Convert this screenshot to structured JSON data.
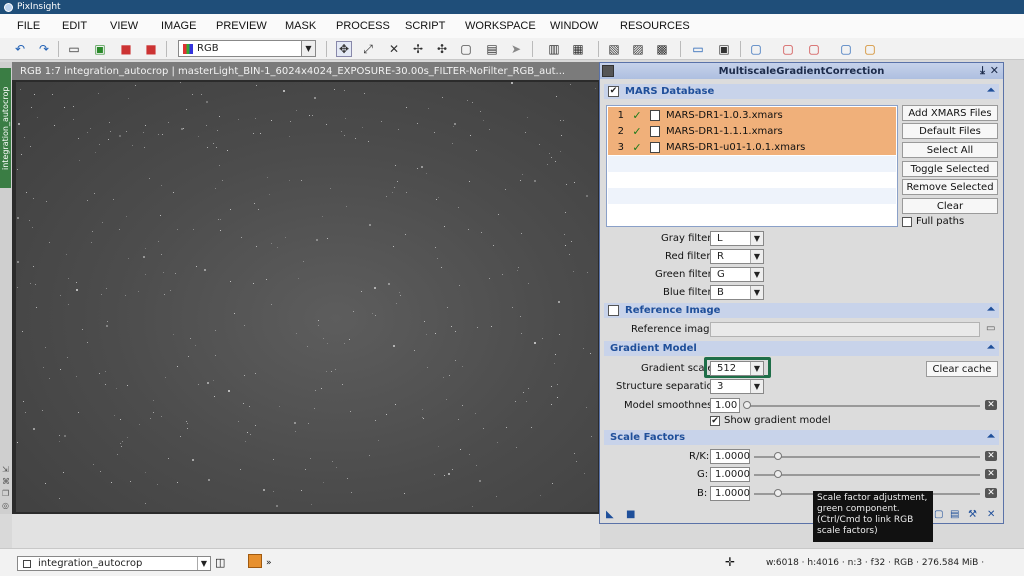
{
  "app": {
    "title": "PixInsight"
  },
  "menu": [
    "FILE",
    "EDIT",
    "VIEW",
    "IMAGE",
    "PREVIEW",
    "MASK",
    "PROCESS",
    "SCRIPT",
    "WORKSPACE",
    "WINDOW",
    "RESOURCES"
  ],
  "toolbar": {
    "channel_select": "RGB"
  },
  "image_window": {
    "title": "RGB 1:7 integration_autocrop | masterLight_BIN-1_6024x4024_EXPOSURE-30.00s_FILTER-NoFilter_RGB_aut...",
    "side_tab": "integration_autocrop"
  },
  "dialog": {
    "title": "MultiscaleGradientCorrection",
    "mars": {
      "header": "MARS Database",
      "enabled": true,
      "files": [
        {
          "num": "1",
          "name": "MARS-DR1-1.0.3.xmars"
        },
        {
          "num": "2",
          "name": "MARS-DR1-1.1.1.xmars"
        },
        {
          "num": "3",
          "name": "MARS-DR1-u01-1.0.1.xmars"
        }
      ],
      "buttons": {
        "add": "Add XMARS Files",
        "default": "Default Files",
        "select_all": "Select All",
        "toggle": "Toggle Selected",
        "remove": "Remove Selected",
        "clear": "Clear"
      },
      "full_paths_label": "Full paths",
      "full_paths_checked": false,
      "filters": [
        {
          "label": "Gray filter:",
          "value": "L"
        },
        {
          "label": "Red filter:",
          "value": "R"
        },
        {
          "label": "Green filter:",
          "value": "G"
        },
        {
          "label": "Blue filter:",
          "value": "B"
        }
      ]
    },
    "reference": {
      "header": "Reference Image",
      "enabled": false,
      "label": "Reference image:",
      "value": ""
    },
    "gradient": {
      "header": "Gradient Model",
      "scale_label": "Gradient scale:",
      "scale_value": "512",
      "clear_cache": "Clear cache",
      "structure_label": "Structure separation:",
      "structure_value": "3",
      "smooth_label": "Model smoothness:",
      "smooth_value": "1.00",
      "show_label": "Show gradient model",
      "show_checked": true
    },
    "scale_factors": {
      "header": "Scale Factors",
      "items": [
        {
          "label": "R/K:",
          "value": "1.0000"
        },
        {
          "label": "G:",
          "value": "1.0000"
        },
        {
          "label": "B:",
          "value": "1.0000"
        }
      ]
    }
  },
  "tooltip": {
    "lines": [
      "Scale factor adjustment,",
      "green component.",
      "(Ctrl/Cmd to link RGB",
      "scale factors)"
    ]
  },
  "statusbar": {
    "view": "integration_autocrop",
    "info": "w:6018 · h:4016 · n:3 · f32 · RGB · 276.584 MiB ·"
  },
  "colors": {
    "title_bar": "#1f4e79",
    "section_header": "#c8d3ea",
    "selection": "#f0b07a",
    "side_tab": "#3a7d44",
    "highlight": "#1f6e48"
  }
}
